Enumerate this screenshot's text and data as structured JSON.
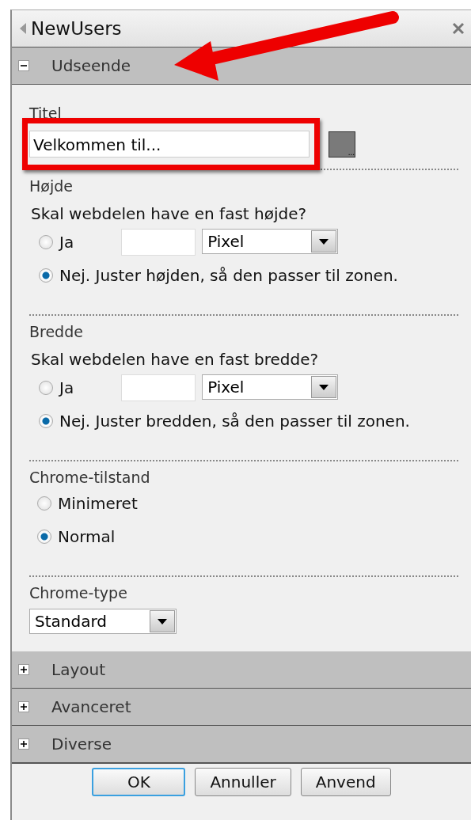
{
  "panel": {
    "title": "NewUsers"
  },
  "sections": [
    {
      "label": "Udseende",
      "expanded": true
    },
    {
      "label": "Layout",
      "expanded": false
    },
    {
      "label": "Avanceret",
      "expanded": false
    },
    {
      "label": "Diverse",
      "expanded": false
    }
  ],
  "appearance": {
    "title_field": {
      "label": "Titel",
      "value": "Velkommen til...",
      "button": "..."
    },
    "groups": [
      {
        "kind": "size",
        "label": "Højde",
        "question": "Skal webdelen have en fast højde?",
        "unit": "Pixel",
        "options": [
          {
            "label": "Ja",
            "selected": false
          },
          {
            "label": "Nej. Juster højden, så den passer til zonen.",
            "selected": true
          }
        ]
      },
      {
        "kind": "size",
        "label": "Bredde",
        "question": "Skal webdelen have en fast bredde?",
        "unit": "Pixel",
        "options": [
          {
            "label": "Ja",
            "selected": false
          },
          {
            "label": "Nej. Juster bredden, så den passer til zonen.",
            "selected": true
          }
        ]
      },
      {
        "kind": "radios",
        "label": "Chrome-tilstand",
        "options": [
          {
            "label": "Minimeret",
            "selected": false
          },
          {
            "label": "Normal",
            "selected": true
          }
        ]
      },
      {
        "kind": "select",
        "label": "Chrome-type",
        "value": "Standard"
      }
    ]
  },
  "buttons": [
    {
      "label": "OK",
      "default": true
    },
    {
      "label": "Annuller",
      "default": false
    },
    {
      "label": "Anvend",
      "default": false
    }
  ],
  "annotations": {
    "arrow": true,
    "highlight_box": true
  }
}
